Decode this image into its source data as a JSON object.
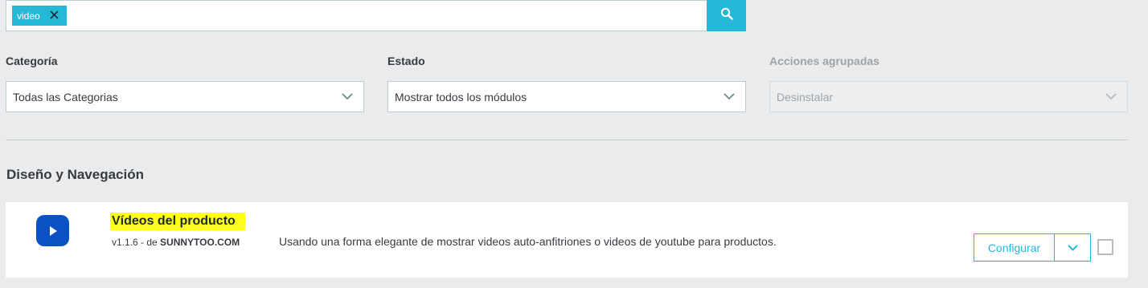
{
  "search": {
    "tag_label": "video",
    "tag_close_icon": "close-icon",
    "button_icon": "search-icon"
  },
  "filters": {
    "category": {
      "label": "Categoría",
      "value": "Todas las Categorias"
    },
    "status": {
      "label": "Estado",
      "value": "Mostrar todos los módulos"
    },
    "bulk": {
      "label": "Acciones agrupadas",
      "value": "Desinstalar",
      "disabled": true
    }
  },
  "section": {
    "title": "Diseño y Navegación"
  },
  "module": {
    "name": "Vídeos del producto",
    "version_prefix": "v1.1.6 - de ",
    "author": "SUNNYTOO.COM",
    "description": "Usando una forma elegante de mostrar videos auto-anfitriones o videos de youtube para productos.",
    "configure_label": "Configurar",
    "icon": "play-icon"
  },
  "colors": {
    "accent": "#25b9d7",
    "highlight": "#ffff1a",
    "logo": "#0a52c4"
  }
}
